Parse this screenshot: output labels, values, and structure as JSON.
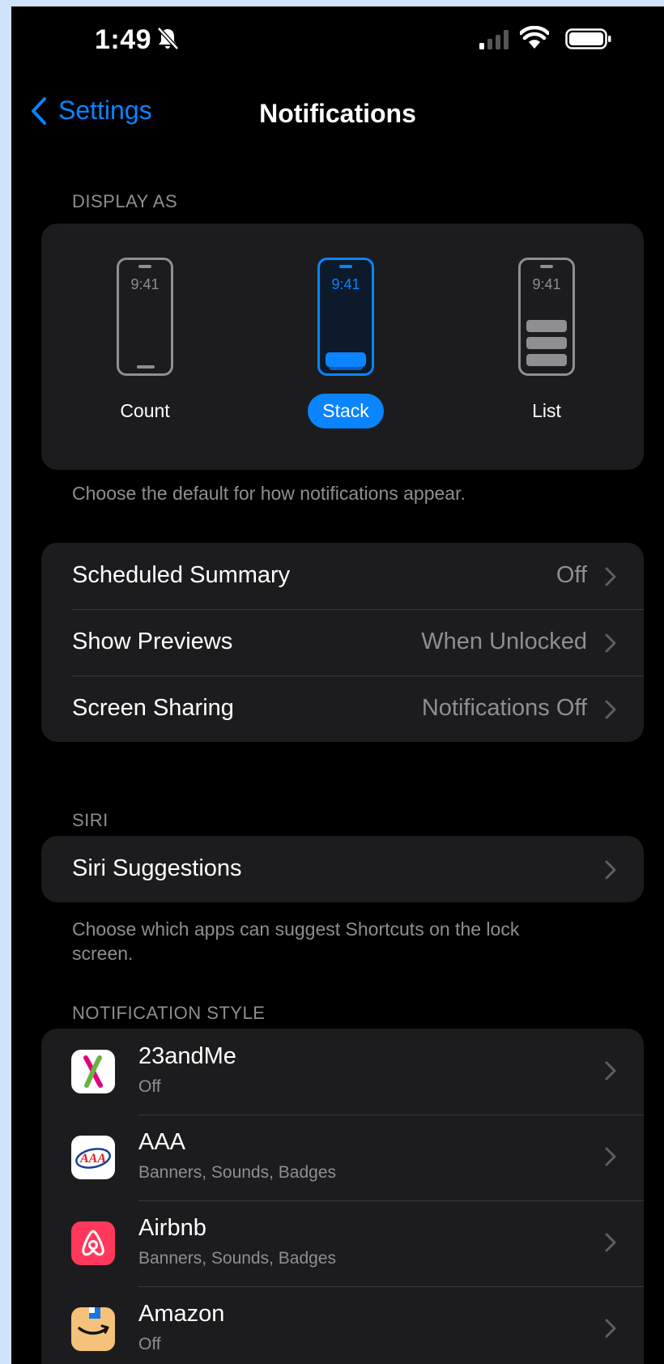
{
  "status_bar": {
    "time": "1:49"
  },
  "nav": {
    "back_label": "Settings",
    "title": "Notifications"
  },
  "display_as": {
    "header": "DISPLAY AS",
    "clock": "9:41",
    "options": [
      {
        "label": "Count",
        "selected": false
      },
      {
        "label": "Stack",
        "selected": true
      },
      {
        "label": "List",
        "selected": false
      }
    ],
    "footnote": "Choose the default for how notifications appear."
  },
  "settings_rows": [
    {
      "label": "Scheduled Summary",
      "value": "Off"
    },
    {
      "label": "Show Previews",
      "value": "When Unlocked"
    },
    {
      "label": "Screen Sharing",
      "value": "Notifications Off"
    }
  ],
  "siri": {
    "header": "SIRI",
    "row_label": "Siri Suggestions",
    "footnote": "Choose which apps can suggest Shortcuts on the lock screen."
  },
  "notification_style": {
    "header": "NOTIFICATION STYLE",
    "apps": [
      {
        "name": "23andMe",
        "subtitle": "Off",
        "icon": "23andme-icon"
      },
      {
        "name": "AAA",
        "subtitle": "Banners, Sounds, Badges",
        "icon": "aaa-icon"
      },
      {
        "name": "Airbnb",
        "subtitle": "Banners, Sounds, Badges",
        "icon": "airbnb-icon"
      },
      {
        "name": "Amazon",
        "subtitle": "Off",
        "icon": "amazon-icon"
      }
    ]
  },
  "colors": {
    "accent": "#0a84ff",
    "background": "#000000",
    "group": "#1c1c1e",
    "secondary_text": "#8e8e93"
  }
}
